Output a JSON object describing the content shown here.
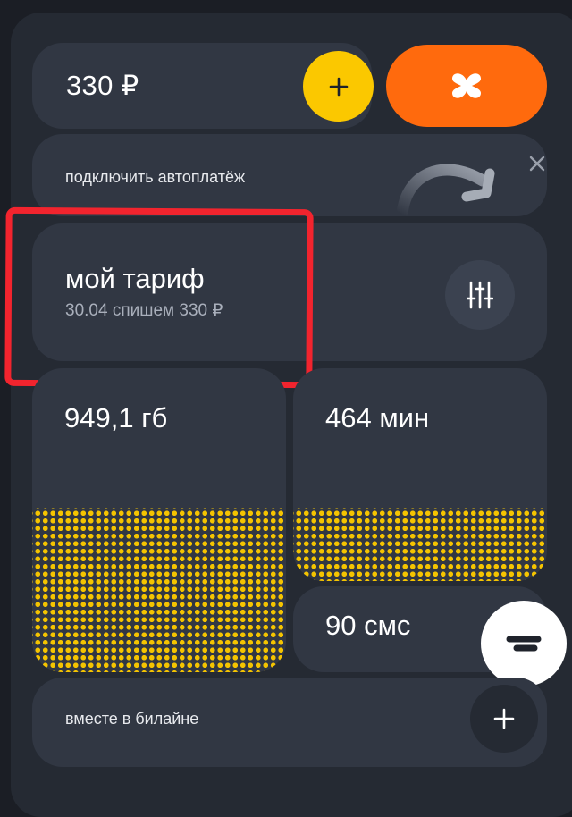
{
  "balance": {
    "value": "330 ₽"
  },
  "autopay": {
    "label": "подключить автоплатёж"
  },
  "tariff": {
    "title": "мой тариф",
    "subtitle": "30.04 спишем 330 ₽"
  },
  "remains": {
    "internet": "949,1 гб",
    "minutes": "464 мин",
    "sms": "90 смс"
  },
  "together": {
    "label": "вместе в билайне"
  },
  "colors": {
    "accent_yellow": "#fbc800",
    "accent_orange": "#ff6a0d",
    "highlight_red": "#f2242e",
    "card": "#313743",
    "background": "#1b1e25"
  },
  "icons": [
    "plus-icon",
    "cross-logo-icon",
    "curved-arrow-icon",
    "close-icon",
    "sliders-icon",
    "chat-icon"
  ]
}
